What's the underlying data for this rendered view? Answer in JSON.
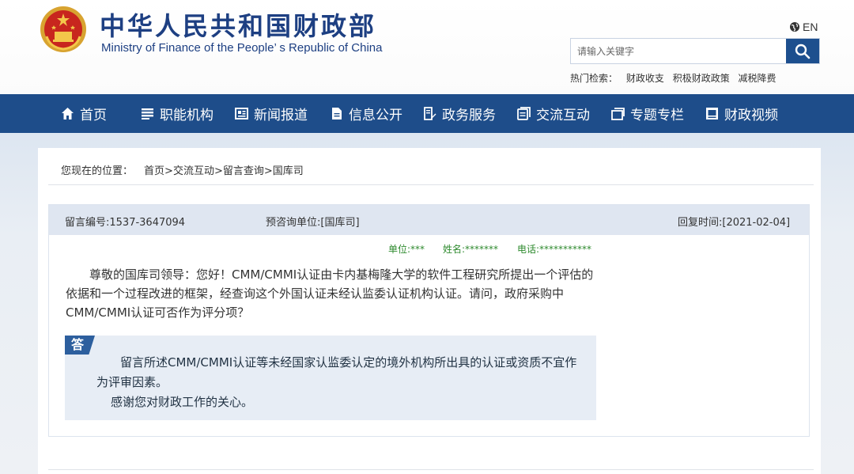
{
  "header": {
    "title_cn": "中华人民共和国财政部",
    "title_en": "Ministry of Finance of the People’ s Republic of China",
    "lang_label": "EN",
    "search_placeholder": "请输入关键字",
    "hot_label": "热门检索：",
    "hot_links": [
      "财政收支",
      "积极财政政策",
      "减税降费"
    ]
  },
  "nav": {
    "items": [
      {
        "label": "首页",
        "icon": "home-icon"
      },
      {
        "label": "职能机构",
        "icon": "list-icon"
      },
      {
        "label": "新闻报道",
        "icon": "newspaper-icon"
      },
      {
        "label": "信息公开",
        "icon": "document-icon"
      },
      {
        "label": "政务服务",
        "icon": "form-edit-icon"
      },
      {
        "label": "交流互动",
        "icon": "chat-icon"
      },
      {
        "label": "专题专栏",
        "icon": "window-icon"
      },
      {
        "label": "财政视频",
        "icon": "video-icon"
      }
    ]
  },
  "breadcrumb": {
    "label": "您现在的位置：",
    "path": [
      "首页",
      "交流互动",
      "留言查询",
      "国库司"
    ]
  },
  "message": {
    "id": "留言编号:1537-3647094",
    "dept": "预咨询单位:[国库司]",
    "reply_time": "回复时间:[2021-02-04]",
    "unit": "单位:***",
    "name": "姓名:*******",
    "phone": "电话:***********",
    "question": "尊敬的国库司领导：您好！CMM/CMMI认证由卡内基梅隆大学的软件工程研究所提出一个评估的依据和一个过程改进的框架，经查询这个外国认证未经认监委认证机构认证。请问，政府采购中CMM/CMMI认证可否作为评分项？",
    "answer_tag": "答",
    "answer_p1": "留言所述CMM/CMMI认证等未经国家认监委认定的境外机构所出具的认证或资质不宜作为评审因素。",
    "answer_p2": "感谢您对财政工作的关心。"
  },
  "colors": {
    "brand": "#1e4d8a",
    "title": "#1d3f82",
    "meta_green": "#2e8a2e",
    "answer_bg": "#e7edf5"
  }
}
